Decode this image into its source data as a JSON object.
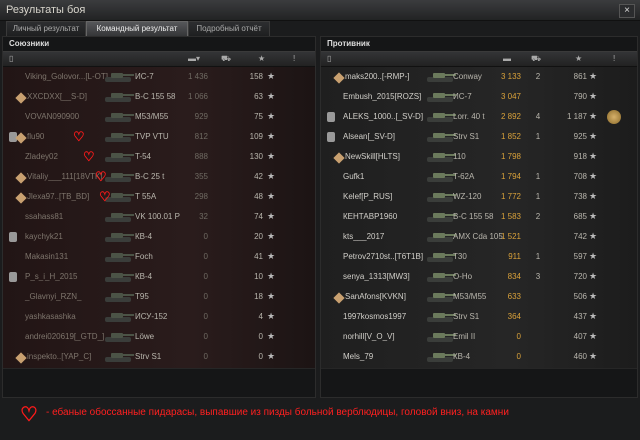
{
  "window": {
    "title": "Результаты боя",
    "close_label": "×"
  },
  "tabs": [
    {
      "label": "Личный результат",
      "active": false
    },
    {
      "label": "Командный результат",
      "active": true
    },
    {
      "label": "Подробный отчёт",
      "active": false
    }
  ],
  "allies": {
    "title": "Союзники",
    "columns_icons": [
      "vehicle-icon",
      "damage-icon",
      "frags-icon",
      "xp-icon",
      "info-icon"
    ],
    "rows": [
      {
        "name": "Viking_Golovor...[L-OT]",
        "tank": "ИС-7",
        "damage": "1 436",
        "kills": "",
        "xp": "158",
        "dim": true
      },
      {
        "name": "XXCDXX[__S-D]",
        "tank": "В-С 155 58",
        "damage": "1 066",
        "kills": "",
        "xp": "63",
        "dim": true
      },
      {
        "name": "VOVAN090900",
        "tank": "M53/M55",
        "damage": "929",
        "kills": "",
        "xp": "75",
        "dim": true
      },
      {
        "name": "flu90",
        "tank": "TVP VTU",
        "damage": "812",
        "kills": "",
        "xp": "109",
        "dim": true
      },
      {
        "name": "Zladey02",
        "tank": "T-54",
        "damage": "888",
        "kills": "",
        "xp": "130",
        "dim": true
      },
      {
        "name": "Vitaliy___111[18VTK]",
        "tank": "B-C 25 t",
        "damage": "355",
        "kills": "",
        "xp": "42",
        "dim": true
      },
      {
        "name": "Jlexa97..[TB_BD]",
        "tank": "T 55A",
        "damage": "298",
        "kills": "",
        "xp": "48",
        "dim": true
      },
      {
        "name": "ssahass81",
        "tank": "VK 100.01 P",
        "damage": "32",
        "kills": "",
        "xp": "74",
        "dim": true
      },
      {
        "name": "kaychyk21",
        "tank": "КВ-4",
        "damage": "0",
        "kills": "",
        "xp": "20",
        "dim": true
      },
      {
        "name": "Makasin131",
        "tank": "Foch",
        "damage": "0",
        "kills": "",
        "xp": "41",
        "dim": true
      },
      {
        "name": "P_s_i_H_2015",
        "tank": "КВ-4",
        "damage": "0",
        "kills": "",
        "xp": "10",
        "dim": true
      },
      {
        "name": "_Glavnyi_RZN_",
        "tank": "T95",
        "damage": "0",
        "kills": "",
        "xp": "18",
        "dim": true
      },
      {
        "name": "yashkasashka",
        "tank": "ИСУ-152",
        "damage": "0",
        "kills": "",
        "xp": "4",
        "dim": true
      },
      {
        "name": "andrei020619[_GTD_]",
        "tank": "Löwe",
        "damage": "0",
        "kills": "",
        "xp": "0",
        "dim": true
      },
      {
        "name": "inspekto..[YAP_C]",
        "tank": "Strv S1",
        "damage": "0",
        "kills": "",
        "xp": "0",
        "dim": true
      }
    ]
  },
  "enemies": {
    "title": "Противник",
    "columns_icons": [
      "vehicle-icon",
      "damage-icon",
      "frags-icon",
      "xp-icon",
      "info-icon"
    ],
    "rows": [
      {
        "name": "maks200..[-RMP-]",
        "tank": "Conway",
        "damage": "3 133",
        "kills": "2",
        "xp": "861"
      },
      {
        "name": "Embush_2015[ROZS]",
        "tank": "ИС-7",
        "damage": "3 047",
        "kills": "",
        "xp": "790"
      },
      {
        "name": "ALEKS_1000..[_SV-D]",
        "tank": "Lorr. 40 t",
        "damage": "2 892",
        "kills": "4",
        "xp": "1 187"
      },
      {
        "name": "Alsean[_SV-D]",
        "tank": "Strv S1",
        "damage": "1 852",
        "kills": "1",
        "xp": "925"
      },
      {
        "name": "NewSkill[HLTS]",
        "tank": "110",
        "damage": "1 798",
        "kills": "",
        "xp": "918"
      },
      {
        "name": "Gufk1",
        "tank": "T-62A",
        "damage": "1 794",
        "kills": "1",
        "xp": "708"
      },
      {
        "name": "Kelef[P_RUS]",
        "tank": "WZ-120",
        "damage": "1 772",
        "kills": "1",
        "xp": "738"
      },
      {
        "name": "КЕНТАВР1960",
        "tank": "B-C 155 58",
        "damage": "1 583",
        "kills": "2",
        "xp": "685"
      },
      {
        "name": "kts___2017",
        "tank": "AMX Cda 105",
        "damage": "1 521",
        "kills": "",
        "xp": "742"
      },
      {
        "name": "Petrov2710st..[T6T1B]",
        "tank": "T30",
        "damage": "911",
        "kills": "1",
        "xp": "597"
      },
      {
        "name": "senya_1313[MW3]",
        "tank": "O-Ho",
        "damage": "834",
        "kills": "3",
        "xp": "720"
      },
      {
        "name": "SanAfons[KVKN]",
        "tank": "M53/M55",
        "damage": "633",
        "kills": "",
        "xp": "506"
      },
      {
        "name": "1997kosmos1997",
        "tank": "Strv S1",
        "damage": "364",
        "kills": "",
        "xp": "437"
      },
      {
        "name": "norhill[V_O_V]",
        "tank": "Emil II",
        "damage": "0",
        "kills": "",
        "xp": "407"
      },
      {
        "name": "Mels_79",
        "tank": "КВ-4",
        "damage": "0",
        "kills": "",
        "xp": "460"
      }
    ]
  },
  "legend": {
    "text": "- ебаные обоссанные пидарасы, выпавшие из пизды больной верблюдицы, головой вниз, на камни"
  },
  "colors": {
    "heart": "#ff1a1a",
    "ally_row": "#2a1c1c",
    "enemy_row": "#262626"
  }
}
